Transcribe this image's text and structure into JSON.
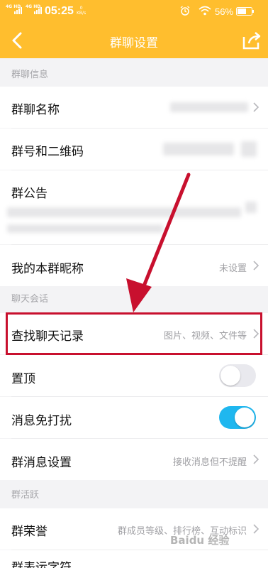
{
  "status_bar": {
    "net1": "4G HD",
    "net2": "4G HD",
    "time": "05:25",
    "speed_value": "0",
    "speed_unit": "KB/s",
    "battery_percent": "56%"
  },
  "title_bar": {
    "title": "群聊设置"
  },
  "sections": {
    "group_info": "群聊信息",
    "chat_session": "聊天会话",
    "group_activity": "群活跃"
  },
  "rows": {
    "group_name": {
      "label": "群聊名称"
    },
    "group_id_qr": {
      "label": "群号和二维码"
    },
    "announcement": {
      "label": "群公告"
    },
    "my_nickname": {
      "label": "我的本群昵称",
      "value": "未设置"
    },
    "search_history": {
      "label": "查找聊天记录",
      "value": "图片、视频、文件等"
    },
    "pin_top": {
      "label": "置顶"
    },
    "do_not_disturb": {
      "label": "消息免打扰"
    },
    "message_settings": {
      "label": "群消息设置",
      "value": "接收消息但不提醒"
    },
    "group_honor": {
      "label": "群荣誉",
      "value": "群成员等级、排行榜、互动标识"
    },
    "next_row_partial": {
      "label": "群表运字符"
    }
  },
  "toggles": {
    "pin_top_on": false,
    "do_not_disturb_on": true
  },
  "colors": {
    "brand": "#ffbe2e",
    "toggle_on": "#1fb7ef",
    "toggle_off": "#e9e9ee",
    "highlight": "#c8102e"
  },
  "watermark": "Baidu 经验"
}
